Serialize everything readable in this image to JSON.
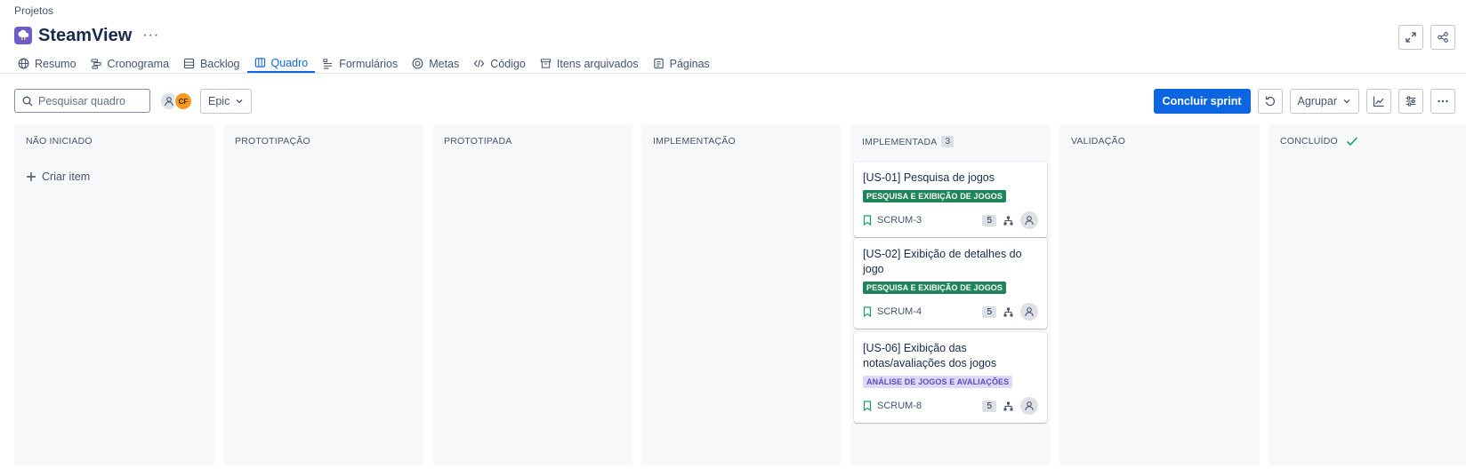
{
  "breadcrumb": "Projetos",
  "project": {
    "name": "SteamView",
    "more": "···"
  },
  "tabs": [
    {
      "label": "Resumo",
      "icon": "globe-icon",
      "active": false
    },
    {
      "label": "Cronograma",
      "icon": "timeline-icon",
      "active": false
    },
    {
      "label": "Backlog",
      "icon": "backlog-icon",
      "active": false
    },
    {
      "label": "Quadro",
      "icon": "board-icon",
      "active": true
    },
    {
      "label": "Formulários",
      "icon": "form-icon",
      "active": false
    },
    {
      "label": "Metas",
      "icon": "target-icon",
      "active": false
    },
    {
      "label": "Código",
      "icon": "code-icon",
      "active": false
    },
    {
      "label": "Itens arquivados",
      "icon": "archive-icon",
      "active": false
    },
    {
      "label": "Páginas",
      "icon": "page-icon",
      "active": false
    }
  ],
  "toolbar": {
    "search_placeholder": "Pesquisar quadro",
    "avatar_initials": "CF",
    "epic_label": "Epic",
    "complete_sprint": "Concluir sprint",
    "group_label": "Agrupar"
  },
  "columns": [
    {
      "title": "NÃO INICIADO",
      "create_label": "Criar item"
    },
    {
      "title": "PROTOTIPAÇÃO"
    },
    {
      "title": "PROTOTIPADA"
    },
    {
      "title": "IMPLEMENTAÇÃO"
    },
    {
      "title": "IMPLEMENTADA",
      "count": "3"
    },
    {
      "title": "VALIDAÇÃO"
    },
    {
      "title": "CONCLUÍDO"
    }
  ],
  "cards": [
    {
      "title": "[US-01] Pesquisa de jogos",
      "epic": "PESQUISA E EXIBIÇÃO DE JOGOS",
      "key": "SCRUM-3",
      "points": "5"
    },
    {
      "title": "[US-02] Exibição de detalhes do jogo",
      "epic": "PESQUISA E EXIBIÇÃO DE JOGOS",
      "key": "SCRUM-4",
      "points": "5"
    },
    {
      "title": "[US-06] Exibição das notas/avaliações dos jogos",
      "epic": "ANÁLISE DE JOGOS E AVALIAÇÕES",
      "key": "SCRUM-8",
      "points": "5"
    }
  ],
  "colors": {
    "accent": "#0c66e4",
    "epic_green": "#1f845a",
    "epic_purple_bg": "#dfd8fd",
    "epic_purple_text": "#5e4db2",
    "project_icon": "#6e5dc6",
    "done_check": "#22a06b"
  }
}
